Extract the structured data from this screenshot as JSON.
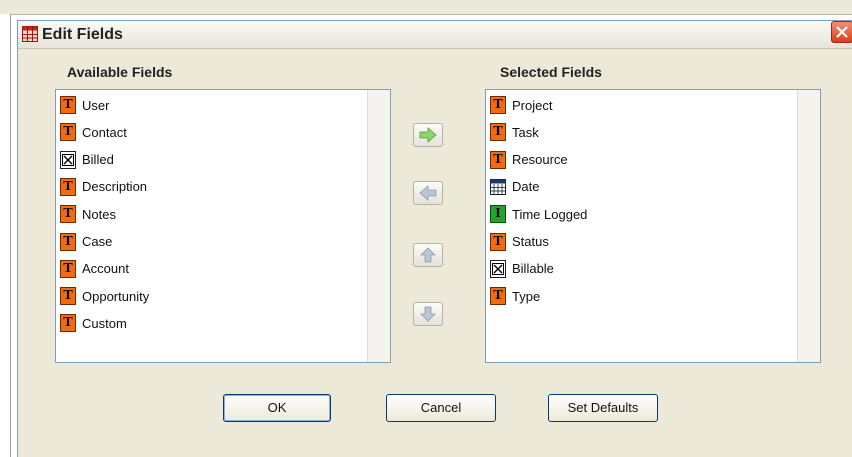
{
  "dialog": {
    "title": "Edit Fields",
    "available_heading": "Available Fields",
    "selected_heading": "Selected Fields",
    "available_fields": [
      {
        "label": "User",
        "icon": "text-field-icon"
      },
      {
        "label": "Contact",
        "icon": "text-field-icon"
      },
      {
        "label": "Billed",
        "icon": "boolean-field-icon"
      },
      {
        "label": "Description",
        "icon": "text-field-icon"
      },
      {
        "label": "Notes",
        "icon": "text-field-icon"
      },
      {
        "label": "Case",
        "icon": "text-field-icon"
      },
      {
        "label": "Account",
        "icon": "text-field-icon"
      },
      {
        "label": "Opportunity",
        "icon": "text-field-icon"
      },
      {
        "label": "Custom",
        "icon": "text-field-icon"
      }
    ],
    "selected_fields": [
      {
        "label": "Project",
        "icon": "text-field-icon"
      },
      {
        "label": "Task",
        "icon": "text-field-icon"
      },
      {
        "label": "Resource",
        "icon": "text-field-icon"
      },
      {
        "label": "Date",
        "icon": "date-field-icon"
      },
      {
        "label": "Time Logged",
        "icon": "integer-field-icon"
      },
      {
        "label": "Status",
        "icon": "text-field-icon"
      },
      {
        "label": "Billable",
        "icon": "boolean-field-icon"
      },
      {
        "label": "Type",
        "icon": "text-field-icon"
      }
    ],
    "buttons": {
      "ok": "OK",
      "cancel": "Cancel",
      "set_defaults": "Set Defaults"
    }
  },
  "colors": {
    "text_icon": "#f26b10",
    "integer_icon": "#22a62a",
    "add_arrow": "#8ed36b",
    "disabled_arrow": "#b9c6d6",
    "close_button": "#d8401c"
  }
}
